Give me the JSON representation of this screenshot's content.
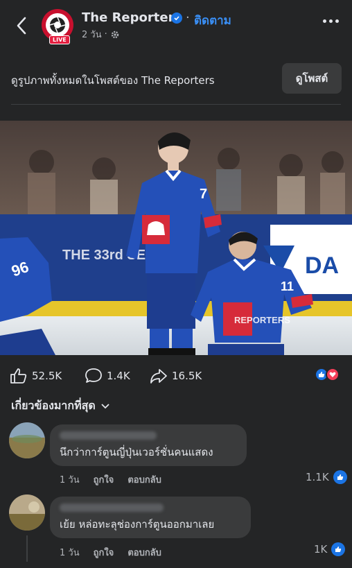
{
  "header": {
    "page_name": "The Reporters",
    "follow_label": "ติดตาม",
    "time": "2 วัน",
    "live_label": "LIVE",
    "icons": [
      "back-arrow-icon",
      "verified-icon",
      "globe-gear-icon",
      "more-icon"
    ]
  },
  "post": {
    "caption": "ดูรูปภาพทั้งหมดในโพสต์ของ The Reporters",
    "view_post_label": "ดูโพสต์",
    "photo_watermark": "REPORTERS",
    "photo_banner_text": "THE 33rd SEA",
    "photo_sponsor": "DA"
  },
  "reactions": {
    "likes": "52.5K",
    "comments": "1.4K",
    "shares": "16.5K",
    "colors": {
      "like": "#1b74e4",
      "love": "#f33e58"
    }
  },
  "comments_filter": {
    "label": "เกี่ยวข้องมากที่สุด"
  },
  "comments": [
    {
      "text": "นึกว่าการ์ตูนญี่ปุ่นเวอร์ชั่นคนแสดง",
      "time": "1 วัน",
      "like_label": "ถูกใจ",
      "reply_label": "ตอบกลับ",
      "like_count": "1.1K"
    },
    {
      "text": "เย้ย หล่อทะลุช่องการ์ตูนออกมาเลย",
      "time": "1 วัน",
      "like_label": "ถูกใจ",
      "reply_label": "ตอบกลับ",
      "like_count": "1K"
    }
  ]
}
